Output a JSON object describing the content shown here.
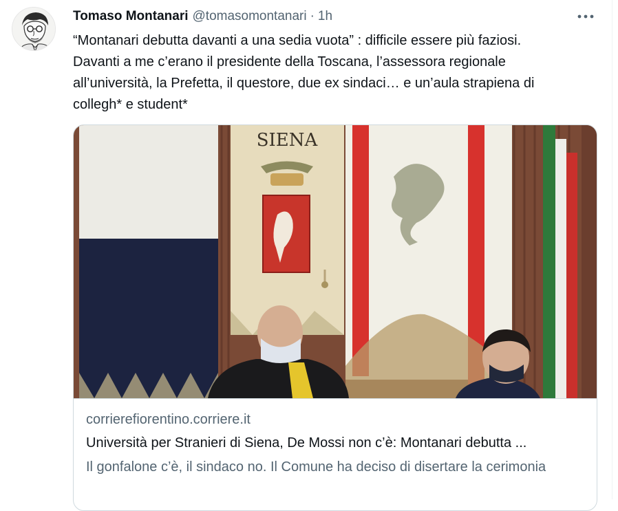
{
  "tweet": {
    "author_name": "Tomaso Montanari",
    "handle": "@tomasomontanari",
    "separator": "·",
    "time": "1h",
    "more_label": "•••",
    "text": "“Montanari debutta davanti a una sedia vuota” : difficile essere più faziosi.\nDavanti a me c’erano il presidente della Toscana, l’assessora regionale\nall’università, la Prefetta, il questore, due ex sindaci… e un’aula strapiena di\ncollegh* e student*"
  },
  "card": {
    "domain": "corrierefiorentino.corriere.it",
    "title": "Università per Stranieri di Siena, De Mossi non c’è: Montanari debutta ...",
    "description": "Il gonfalone c’è, il sindaco no. Il Comune ha deciso di disertare la cerimonia",
    "image_banner_text": "SIENA"
  },
  "icons": {
    "avatar": "author-avatar-sketch",
    "more": "more-options-icon"
  }
}
